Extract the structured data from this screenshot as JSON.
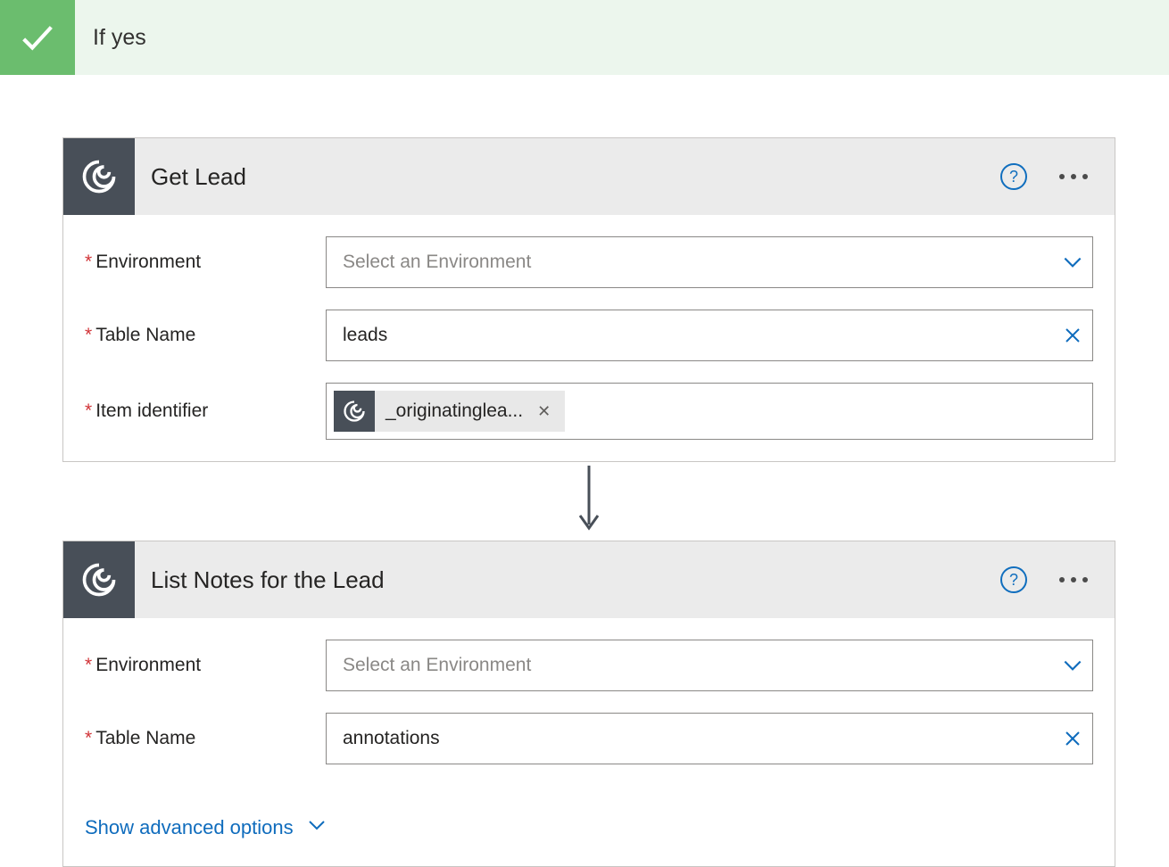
{
  "condition": {
    "title": "If yes"
  },
  "actions": {
    "get_lead": {
      "title": "Get Lead",
      "fields": {
        "environment": {
          "label": "Environment",
          "placeholder": "Select an Environment"
        },
        "table_name": {
          "label": "Table Name",
          "value": "leads"
        },
        "item_identifier": {
          "label": "Item identifier",
          "token_label": "_originatinglea..."
        }
      }
    },
    "list_notes": {
      "title": "List Notes for the Lead",
      "fields": {
        "environment": {
          "label": "Environment",
          "placeholder": "Select an Environment"
        },
        "table_name": {
          "label": "Table Name",
          "value": "annotations"
        }
      },
      "advanced_label": "Show advanced options"
    }
  },
  "glyphs": {
    "help": "?",
    "close_x": "✕",
    "token_x": "✕"
  }
}
